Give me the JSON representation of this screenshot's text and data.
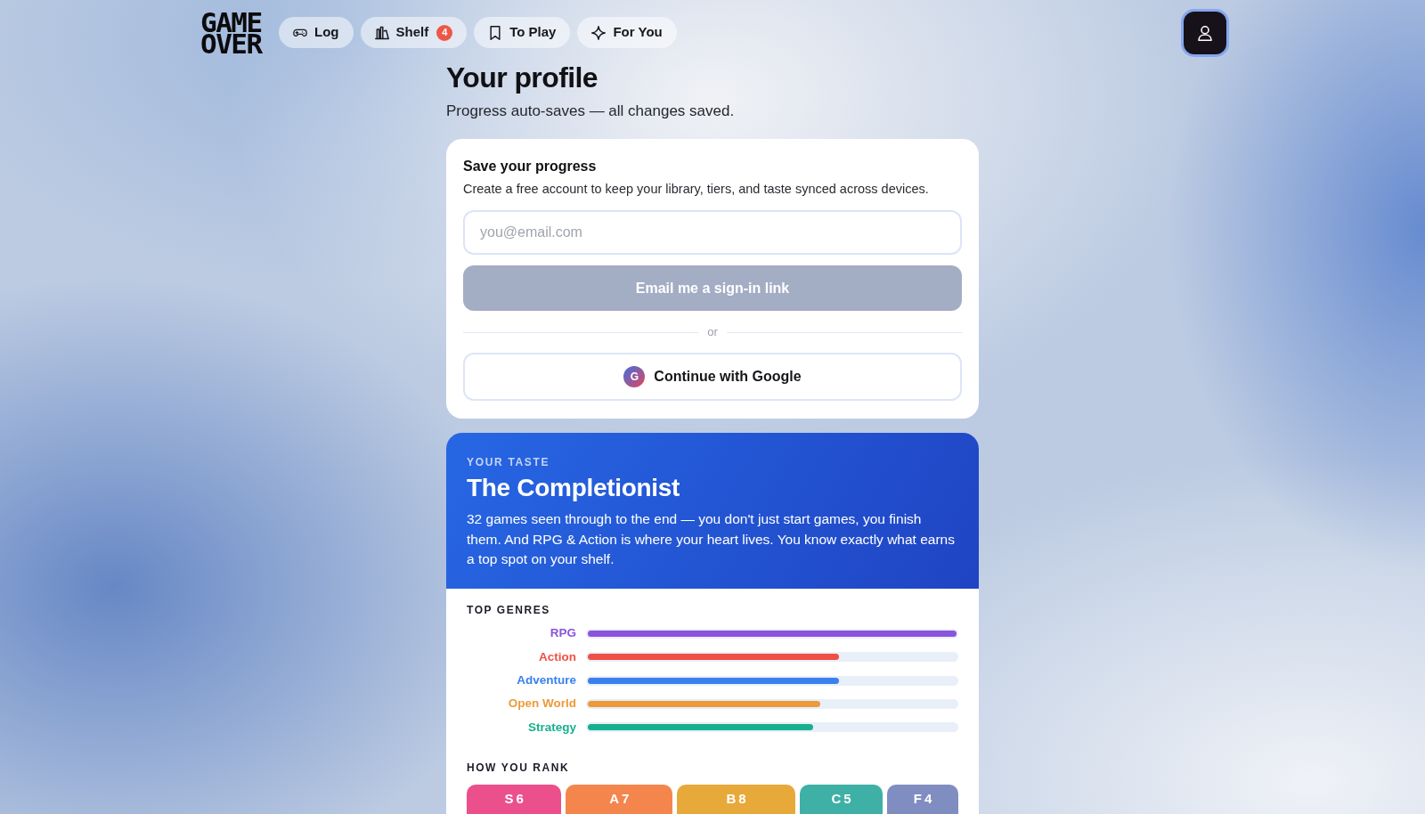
{
  "nav": {
    "logo": "GAME OVER",
    "tabs": [
      {
        "label": "Log",
        "selected": false
      },
      {
        "label": "Shelf",
        "badge": "4",
        "selected": false
      },
      {
        "label": "To Play",
        "selected": false
      },
      {
        "label": "For You",
        "selected": false
      }
    ],
    "profile_button": {
      "selected": true
    }
  },
  "page": {
    "title": "Your profile",
    "subtitle": "Progress auto-saves — all changes saved."
  },
  "save_card": {
    "title": "Save your progress",
    "description": "Create a free account to keep your library, tiers, and taste synced across devices.",
    "email_field": {
      "placeholder": "you@email.com"
    },
    "email_button": {
      "label": "Email me a sign-in link",
      "disabled": true
    },
    "separator": "or",
    "google_button": {
      "icon_letter": "G",
      "label": "Continue with Google"
    }
  },
  "taste_card": {
    "eyebrow": "YOUR TASTE",
    "title": "The Completionist",
    "summary": "32 games seen through to the end — you don't just start games, you finish them. And RPG & Action is where your heart lives. You know exactly what earns a top spot on your shelf.",
    "genres_heading": "TOP GENRES",
    "genres": [
      {
        "name": "RPG",
        "level": 1.0,
        "color": "#8a55dd"
      },
      {
        "name": "Action",
        "level": 0.68,
        "color": "#ef5045"
      },
      {
        "name": "Adventure",
        "level": 0.68,
        "color": "#3a80ee"
      },
      {
        "name": "Open World",
        "level": 0.63,
        "color": "#eb9b3c"
      },
      {
        "name": "Strategy",
        "level": 0.61,
        "color": "#17b08f"
      }
    ],
    "rank_heading": "HOW YOU RANK",
    "ranks": [
      {
        "tier": "S",
        "count": "6",
        "color": "#ec508c"
      },
      {
        "tier": "A",
        "count": "7",
        "color": "#f4864d"
      },
      {
        "tier": "B",
        "count": "8",
        "color": "#e8a93b"
      },
      {
        "tier": "C",
        "count": "5",
        "color": "#3fb0a5"
      },
      {
        "tier": "F",
        "count": "4",
        "color": "#808dc1"
      }
    ]
  }
}
